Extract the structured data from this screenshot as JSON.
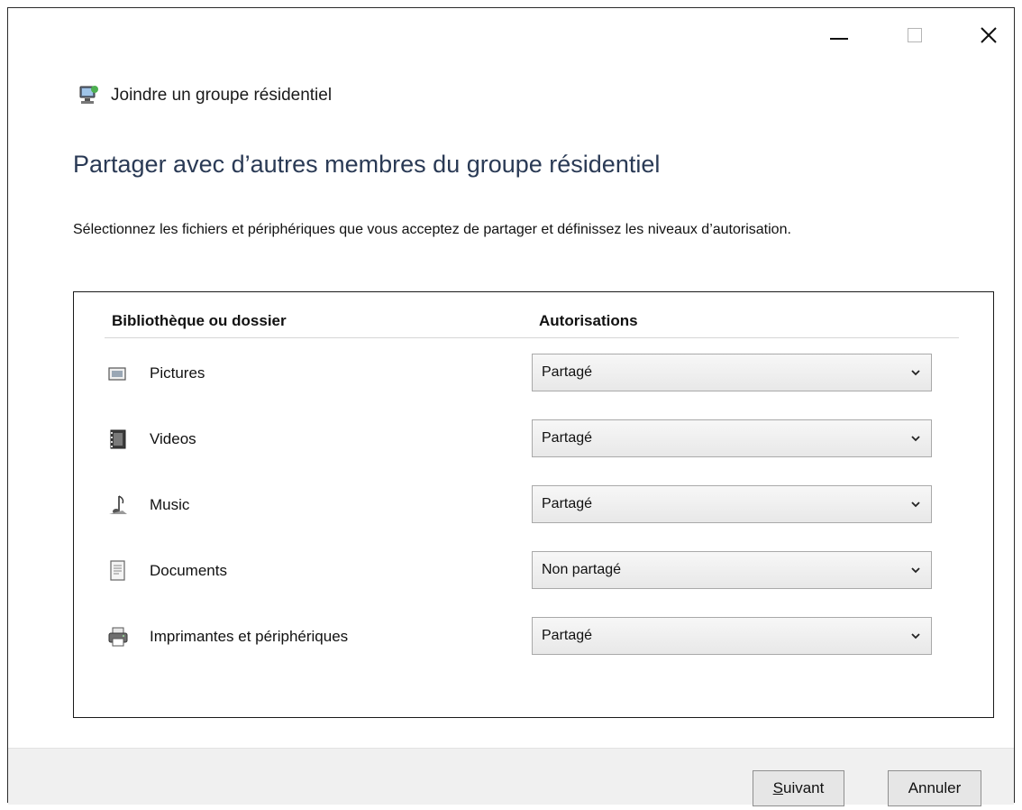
{
  "window": {
    "title": "Joindre un groupe résidentiel",
    "controls": {
      "minimize": "minimize-icon",
      "maximize": "maximize-icon",
      "close": "×"
    }
  },
  "page": {
    "title": "Partager avec d’autres membres du groupe résidentiel",
    "instructions": "Sélectionnez les fichiers et périphériques que vous acceptez de partager et définissez les niveaux d’autorisation."
  },
  "table": {
    "headers": {
      "library": "Bibliothèque ou dossier",
      "permissions": "Autorisations"
    },
    "rows": [
      {
        "icon": "pictures-icon",
        "label": "Pictures",
        "permission": "Partagé"
      },
      {
        "icon": "videos-icon",
        "label": "Videos",
        "permission": "Partagé"
      },
      {
        "icon": "music-icon",
        "label": "Music",
        "permission": "Partagé"
      },
      {
        "icon": "documents-icon",
        "label": "Documents",
        "permission": "Non partagé"
      },
      {
        "icon": "printer-icon",
        "label": "Imprimantes et périphériques",
        "permission": "Partagé"
      }
    ]
  },
  "footer": {
    "next_mnemonic": "S",
    "next_rest": "uivant",
    "cancel": "Annuler"
  }
}
